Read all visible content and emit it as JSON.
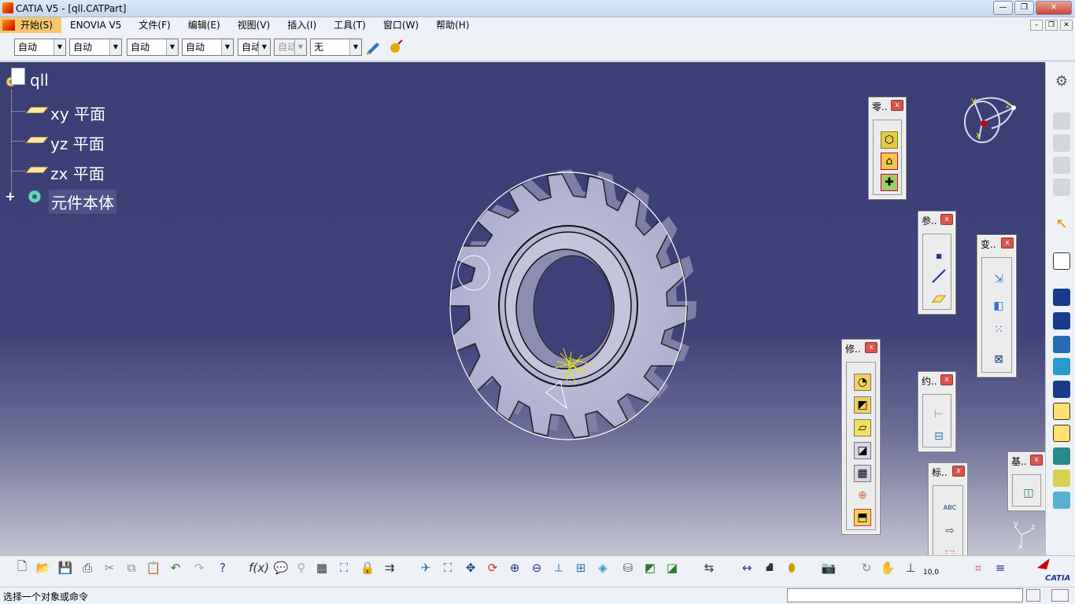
{
  "window": {
    "title": "CATIA V5 - [qll.CATPart]"
  },
  "menubar": {
    "items": [
      "开始(S)",
      "ENOVIA V5",
      "文件(F)",
      "编辑(E)",
      "视图(V)",
      "插入(I)",
      "工具(T)",
      "窗口(W)",
      "帮助(H)"
    ]
  },
  "toolbar": {
    "combos": [
      {
        "value": "自动",
        "enabled": true
      },
      {
        "value": "自动",
        "enabled": true
      },
      {
        "value": "自动",
        "enabled": true
      },
      {
        "value": "自动",
        "enabled": true
      },
      {
        "value": "自动",
        "enabled": true
      },
      {
        "value": "自动",
        "enabled": false
      },
      {
        "value": "无",
        "enabled": true
      }
    ]
  },
  "tree": {
    "root": "qll",
    "items": [
      {
        "label": "xy 平面",
        "icon": "plane-icon"
      },
      {
        "label": "yz 平面",
        "icon": "plane-icon"
      },
      {
        "label": "zx 平面",
        "icon": "plane-icon"
      },
      {
        "label": "元件本体",
        "icon": "body-gear-icon"
      }
    ]
  },
  "palettes": {
    "parts": {
      "title": "零.."
    },
    "reference": {
      "title": "参.."
    },
    "transform": {
      "title": "变.."
    },
    "modify": {
      "title": "修.."
    },
    "constraint": {
      "title": "约.."
    },
    "annotation": {
      "title": "标.."
    },
    "base": {
      "title": "基.."
    }
  },
  "compass": {
    "labels": [
      "y",
      "z",
      "x"
    ]
  },
  "axis_triad": {
    "labels": [
      "y",
      "z",
      "x"
    ]
  },
  "bottom_toolbar": {
    "zoom_value": "10,0"
  },
  "statusbar": {
    "message": "选择一个对象或命令"
  },
  "colors": {
    "viewport_top": "#3b3e75",
    "viewport_bottom": "#c4c5d3",
    "part": "#b7b7d6",
    "highlight": "#ffffff"
  }
}
